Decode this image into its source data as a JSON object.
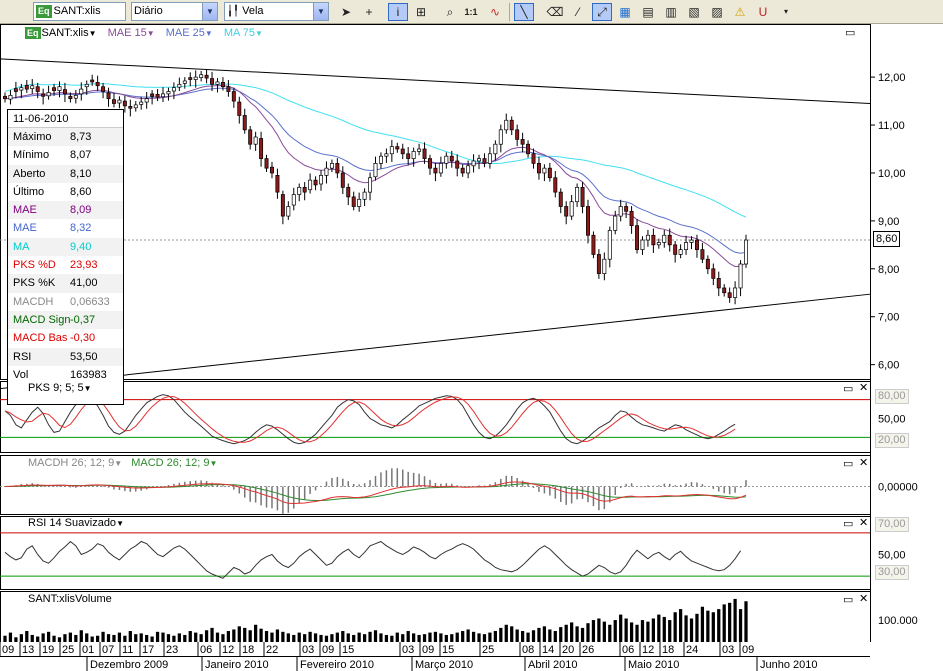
{
  "toolbar": {
    "symbol": "SANT:xlis",
    "symbol_badge": "Eq",
    "period": "Diário",
    "style": "Vela",
    "icons": [
      "cursor-icon",
      "crosshair-icon",
      "info-icon",
      "pattern-icon",
      "zoom-icon",
      "scale-1to1-icon",
      "wave-icon",
      "line-tool-icon",
      "eraser-icon",
      "trendline-icon",
      "fan-icon",
      "chart-a-icon",
      "chart-b-icon",
      "chart-c-icon",
      "chart-d-icon",
      "alert-icon",
      "magnet-icon"
    ],
    "label_1to1": "1:1"
  },
  "main_pane": {
    "legend": {
      "badge": "Eq",
      "symbol": "SANT:xlis",
      "mae15": "MAE 15",
      "mae25": "MAE 25",
      "ma75": "MA 75"
    },
    "current_price_tag": "8,60",
    "price_ticks": [
      "12,00",
      "11,00",
      "10,00",
      "9,00",
      "8,00",
      "7,00",
      "6,00"
    ]
  },
  "infobox": {
    "date": "11-06-2010",
    "rows": [
      {
        "label": "Máximo",
        "value": "8,73",
        "color": "#000000"
      },
      {
        "label": "Mínimo",
        "value": "8,07",
        "color": "#000000"
      },
      {
        "label": "Aberto",
        "value": "8,10",
        "color": "#000000"
      },
      {
        "label": "Último",
        "value": "8,60",
        "color": "#000000"
      },
      {
        "label": "MAE",
        "value": "8,09",
        "color": "#800080"
      },
      {
        "label": "MAE",
        "value": "8,32",
        "color": "#4466cc"
      },
      {
        "label": "MA",
        "value": "9,40",
        "color": "#00cccc"
      },
      {
        "label": "PKS %D",
        "value": "23,93",
        "color": "#dd0000"
      },
      {
        "label": "PKS %K",
        "value": "41,00",
        "color": "#000000"
      },
      {
        "label": "MACDH",
        "value": "0,06633",
        "color": "#888888"
      },
      {
        "label": "MACD Sign",
        "value": "-0,37",
        "color": "#006600"
      },
      {
        "label": "MACD Bas",
        "value": "-0,30",
        "color": "#dd0000"
      },
      {
        "label": "RSI",
        "value": "53,50",
        "color": "#000000"
      },
      {
        "label": "Vol",
        "value": "163983",
        "color": "#000000"
      }
    ]
  },
  "pks_pane": {
    "title": "PKS 9; 5; 5",
    "levels": [
      "80,00",
      "50,00",
      "20,00"
    ]
  },
  "macd_pane": {
    "title_a": "MACDH 26; 12; 9",
    "title_b": "MACD 26; 12; 9",
    "levels": [
      "0,00000"
    ]
  },
  "rsi_pane": {
    "title": "RSI 14 Suavizado",
    "levels": [
      "70,00",
      "50,00",
      "30,00"
    ]
  },
  "volume_pane": {
    "title": "SANT:xlisVolume",
    "levels": [
      "100.000"
    ]
  },
  "x_axis": {
    "days": [
      "09",
      "13",
      "19",
      "25",
      "01",
      "07",
      "11",
      "17",
      "23",
      "06",
      "12",
      "18",
      "22",
      "03",
      "09",
      "15",
      "03",
      "09",
      "15",
      "25",
      "08",
      "14",
      "20",
      "26",
      "06",
      "12",
      "18",
      "24",
      "03",
      "09"
    ],
    "months": [
      "Dezembro 2009",
      "Janeiro 2010",
      "Fevereiro 2010",
      "Março 2010",
      "Abril 2010",
      "Maio 2010",
      "Junho 2010"
    ]
  },
  "colors": {
    "candle_up": "#ffffff",
    "candle_down": "#8b1a1a",
    "mae15": "#8a4a9a",
    "mae25": "#5a70cc",
    "ma75": "#40e0f0",
    "pks_k": "#333333",
    "pks_d": "#e03030",
    "macd": "#e03030",
    "macd_signal": "#2e8b2e",
    "rsi": "#333333",
    "level_red": "#cc0000",
    "level_green": "#009900"
  },
  "chart_data": {
    "type": "candlestick",
    "panes": [
      "price",
      "pks",
      "macd",
      "rsi",
      "volume"
    ],
    "ylim": [
      5.7,
      12.9
    ],
    "last": {
      "date": "11-06-2010",
      "high": 8.73,
      "low": 8.07,
      "open": 8.1,
      "close": 8.6,
      "mae15": 8.09,
      "mae25": 8.32,
      "ma75": 9.4,
      "pks_d": 23.93,
      "pks_k": 41.0,
      "macdh": 0.06633,
      "macd_signal": -0.37,
      "macd_base": -0.3,
      "rsi": 53.5,
      "volume": 163983
    },
    "close": [
      11.55,
      11.62,
      11.7,
      11.78,
      11.75,
      11.82,
      11.7,
      11.6,
      11.68,
      11.72,
      11.8,
      11.65,
      11.55,
      11.62,
      11.75,
      11.85,
      11.9,
      11.82,
      11.7,
      11.55,
      11.45,
      11.52,
      11.4,
      11.35,
      11.42,
      11.48,
      11.55,
      11.6,
      11.58,
      11.65,
      11.7,
      11.78,
      11.85,
      11.92,
      11.95,
      12.0,
      12.05,
      11.98,
      11.85,
      11.9,
      11.8,
      11.7,
      11.5,
      11.2,
      10.9,
      10.6,
      10.75,
      10.3,
      10.1,
      10.0,
      9.6,
      9.1,
      9.3,
      9.55,
      9.7,
      9.6,
      9.85,
      9.75,
      9.95,
      10.1,
      10.2,
      10.0,
      9.7,
      9.5,
      9.3,
      9.45,
      9.6,
      9.9,
      10.2,
      10.35,
      10.4,
      10.55,
      10.5,
      10.4,
      10.3,
      10.45,
      10.5,
      10.3,
      10.1,
      10.0,
      10.2,
      10.35,
      10.25,
      10.1,
      10.0,
      10.15,
      10.25,
      10.3,
      10.2,
      10.4,
      10.6,
      10.9,
      11.1,
      10.9,
      10.7,
      10.6,
      10.4,
      10.2,
      10.0,
      10.1,
      9.9,
      9.6,
      9.3,
      9.1,
      9.4,
      9.7,
      9.3,
      8.7,
      8.3,
      7.9,
      8.2,
      8.8,
      9.1,
      9.3,
      9.2,
      8.9,
      8.4,
      8.6,
      8.7,
      8.5,
      8.55,
      8.7,
      8.5,
      8.3,
      8.4,
      8.55,
      8.6,
      8.4,
      8.2,
      8.0,
      7.8,
      7.6,
      7.5,
      7.4,
      7.6,
      8.1,
      8.6
    ],
    "open_offset": [
      0.05,
      -0.08,
      0.06,
      -0.05,
      0.08,
      -0.06,
      0.1,
      0.05,
      -0.07,
      0.06,
      -0.08,
      0.09,
      0.05,
      -0.06,
      -0.1,
      -0.05,
      0.04,
      0.07,
      0.1,
      0.12,
      0.08,
      -0.06,
      0.1,
      0.04,
      -0.06,
      -0.05,
      -0.07,
      0.05,
      0.06,
      -0.06,
      -0.05,
      -0.07,
      -0.06,
      -0.05,
      0.04,
      -0.05,
      -0.06,
      0.06,
      0.12,
      -0.05,
      0.09,
      0.1,
      0.2,
      0.28,
      0.3,
      0.3,
      -0.15,
      0.42,
      0.2,
      0.12,
      0.35,
      0.45,
      -0.2,
      -0.22,
      -0.15,
      0.1,
      -0.2,
      0.1,
      -0.18,
      -0.15,
      -0.1,
      0.2,
      0.3,
      0.2,
      0.2,
      -0.15,
      -0.15,
      -0.3,
      -0.28,
      -0.15,
      -0.05,
      -0.15,
      0.05,
      0.1,
      0.1,
      -0.15,
      -0.05,
      0.2,
      0.2,
      0.1,
      -0.2,
      -0.15,
      0.1,
      0.15,
      0.1,
      -0.15,
      -0.1,
      -0.05,
      0.1,
      -0.2,
      -0.2,
      -0.3,
      -0.2,
      0.2,
      0.2,
      0.1,
      0.2,
      0.2,
      0.2,
      -0.1,
      0.2,
      0.3,
      0.3,
      0.2,
      -0.3,
      -0.3,
      0.4,
      0.6,
      0.4,
      0.4,
      -0.3,
      -0.6,
      -0.3,
      -0.2,
      0.1,
      0.3,
      0.5,
      -0.2,
      -0.1,
      0.2,
      -0.05,
      -0.15,
      0.2,
      0.2,
      -0.1,
      -0.15,
      -0.05,
      0.2,
      0.2,
      0.2,
      0.2,
      0.2,
      0.1,
      0.1,
      -0.2,
      -0.5,
      -0.5
    ],
    "pks_k": [
      62,
      55,
      40,
      35,
      48,
      60,
      68,
      58,
      40,
      28,
      30,
      45,
      60,
      72,
      80,
      85,
      82,
      70,
      55,
      38,
      28,
      25,
      30,
      42,
      55,
      65,
      75,
      80,
      85,
      88,
      86,
      80,
      70,
      60,
      52,
      45,
      38,
      30,
      22,
      18,
      15,
      12,
      10,
      12,
      15,
      20,
      28,
      35,
      40,
      38,
      32,
      25,
      18,
      12,
      10,
      12,
      18,
      25,
      35,
      45,
      55,
      68,
      75,
      80,
      78,
      72,
      60,
      50,
      45,
      40,
      38,
      35,
      40,
      48,
      55,
      62,
      70,
      74,
      78,
      82,
      84,
      86,
      85,
      80,
      70,
      55,
      40,
      28,
      20,
      18,
      22,
      30,
      40,
      52,
      65,
      75,
      80,
      82,
      78,
      70,
      60,
      45,
      30,
      18,
      12,
      10,
      14,
      20,
      28,
      35,
      40,
      45,
      55,
      62,
      60,
      52,
      45,
      40,
      38,
      35,
      32,
      30,
      35,
      40,
      38,
      32,
      28,
      24,
      20,
      18,
      20,
      25,
      30,
      36,
      41
    ],
    "rsi": [
      52,
      48,
      45,
      47,
      55,
      58,
      50,
      44,
      42,
      47,
      53,
      57,
      62,
      58,
      50,
      52,
      55,
      60,
      58,
      52,
      48,
      45,
      50,
      55,
      58,
      62,
      60,
      55,
      50,
      48,
      52,
      56,
      58,
      55,
      50,
      45,
      40,
      35,
      32,
      30,
      28,
      33,
      38,
      36,
      32,
      34,
      40,
      45,
      48,
      50,
      44,
      40,
      38,
      42,
      48,
      52,
      55,
      50,
      45,
      40,
      42,
      48,
      52,
      55,
      50,
      47,
      52,
      58,
      60,
      62,
      58,
      55,
      52,
      50,
      53,
      57,
      55,
      52,
      48,
      46,
      50,
      53,
      55,
      58,
      60,
      58,
      55,
      50,
      45,
      42,
      38,
      36,
      35,
      34,
      36,
      40,
      45,
      50,
      55,
      58,
      55,
      50,
      45,
      40,
      36,
      33,
      30,
      32,
      36,
      40,
      38,
      34,
      32,
      34,
      40,
      48,
      54,
      50,
      46,
      50,
      52,
      48,
      45,
      50,
      53,
      48,
      44,
      42,
      40,
      38,
      36,
      35,
      36,
      40,
      46,
      53.5
    ],
    "volume": [
      8,
      12,
      6,
      10,
      14,
      9,
      7,
      11,
      13,
      8,
      6,
      10,
      12,
      9,
      15,
      11,
      7,
      8,
      13,
      10,
      9,
      12,
      8,
      14,
      10,
      11,
      9,
      7,
      13,
      12,
      10,
      8,
      11,
      9,
      14,
      12,
      10,
      15,
      18,
      12,
      10,
      14,
      16,
      20,
      18,
      15,
      22,
      17,
      14,
      12,
      16,
      13,
      11,
      9,
      12,
      10,
      13,
      11,
      9,
      8,
      10,
      12,
      14,
      11,
      9,
      12,
      10,
      13,
      15,
      11,
      9,
      8,
      12,
      10,
      14,
      11,
      9,
      10,
      12,
      13,
      11,
      9,
      10,
      12,
      14,
      16,
      13,
      11,
      10,
      12,
      14,
      18,
      22,
      20,
      16,
      14,
      12,
      15,
      18,
      20,
      16,
      14,
      19,
      22,
      25,
      20,
      18,
      24,
      28,
      30,
      26,
      22,
      28,
      35,
      30,
      25,
      22,
      28,
      26,
      30,
      35,
      32,
      28,
      38,
      42,
      34,
      30,
      36,
      45,
      40,
      38,
      42,
      48,
      50,
      55,
      42,
      52
    ]
  }
}
